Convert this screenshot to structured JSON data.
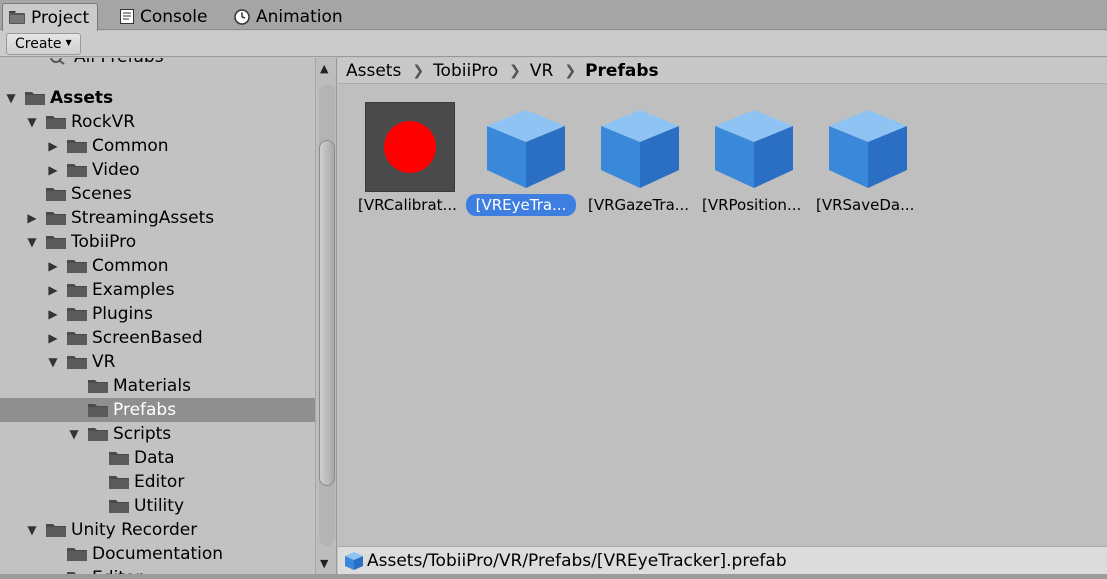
{
  "tabs": [
    {
      "label": "Project",
      "icon": "folder-icon",
      "active": true
    },
    {
      "label": "Console",
      "icon": "console-icon",
      "active": false
    },
    {
      "label": "Animation",
      "icon": "clock-icon",
      "active": false
    }
  ],
  "toolbar": {
    "create_label": "Create"
  },
  "tree": {
    "partial_label": "All Prefabs",
    "items": [
      {
        "label": "Assets",
        "depth": 0,
        "expander": "expanded",
        "bold": true
      },
      {
        "label": "RockVR",
        "depth": 1,
        "expander": "expanded"
      },
      {
        "label": "Common",
        "depth": 2,
        "expander": "collapsed"
      },
      {
        "label": "Video",
        "depth": 2,
        "expander": "collapsed"
      },
      {
        "label": "Scenes",
        "depth": 1,
        "expander": "none"
      },
      {
        "label": "StreamingAssets",
        "depth": 1,
        "expander": "collapsed"
      },
      {
        "label": "TobiiPro",
        "depth": 1,
        "expander": "expanded"
      },
      {
        "label": "Common",
        "depth": 2,
        "expander": "collapsed"
      },
      {
        "label": "Examples",
        "depth": 2,
        "expander": "collapsed"
      },
      {
        "label": "Plugins",
        "depth": 2,
        "expander": "collapsed"
      },
      {
        "label": "ScreenBased",
        "depth": 2,
        "expander": "collapsed"
      },
      {
        "label": "VR",
        "depth": 2,
        "expander": "expanded"
      },
      {
        "label": "Materials",
        "depth": 3,
        "expander": "none"
      },
      {
        "label": "Prefabs",
        "depth": 3,
        "expander": "none",
        "selected": true
      },
      {
        "label": "Scripts",
        "depth": 3,
        "expander": "expanded"
      },
      {
        "label": "Data",
        "depth": 4,
        "expander": "none"
      },
      {
        "label": "Editor",
        "depth": 4,
        "expander": "none"
      },
      {
        "label": "Utility",
        "depth": 4,
        "expander": "none"
      },
      {
        "label": "Unity Recorder",
        "depth": 1,
        "expander": "expanded"
      },
      {
        "label": "Documentation",
        "depth": 2,
        "expander": "none"
      },
      {
        "label": "Editor",
        "depth": 2,
        "expander": "collapsed"
      }
    ]
  },
  "breadcrumb": [
    "Assets",
    "TobiiPro",
    "VR",
    "Prefabs"
  ],
  "assets": [
    {
      "label": "[VRCalibrat...",
      "thumb": "red-dot",
      "selected": false
    },
    {
      "label": "[VREyeTra...",
      "thumb": "blue-cube",
      "selected": true
    },
    {
      "label": "[VRGazeTra...",
      "thumb": "blue-cube",
      "selected": false
    },
    {
      "label": "[VRPosition...",
      "thumb": "blue-cube",
      "selected": false
    },
    {
      "label": "[VRSaveDa...",
      "thumb": "blue-cube",
      "selected": false
    }
  ],
  "status": {
    "path": "Assets/TobiiPro/VR/Prefabs/[VREyeTracker].prefab",
    "icon": "prefab-cube-icon"
  },
  "colors": {
    "selection": "#3d7ee0",
    "folder": "#4a4a4a",
    "tree_selected": "#8f8f8f"
  }
}
